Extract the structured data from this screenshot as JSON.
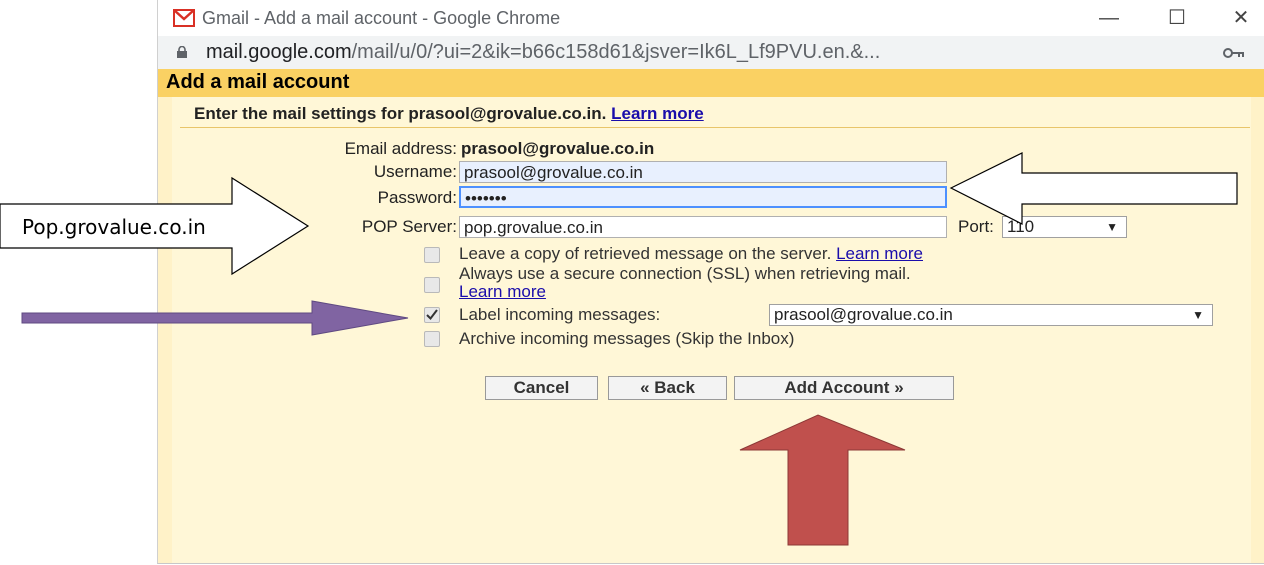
{
  "window": {
    "title": "Gmail - Add a mail account - Google Chrome",
    "minimize": "—",
    "maximize": "☐",
    "close": "✕"
  },
  "addressbar": {
    "host": "mail.google.com",
    "path": "/mail/u/0/?ui=2&ik=b66c158d61&jsver=Ik6L_Lf9PVU.en.&..."
  },
  "dialog": {
    "title": "Add a mail account",
    "intro_text": "Enter the mail settings for prasool@grovalue.co.in.",
    "intro_link": "Learn more",
    "email_label": "Email address:",
    "email_value": "prasool@grovalue.co.in",
    "username_label": "Username:",
    "username_value": "prasool@grovalue.co.in",
    "password_label": "Password:",
    "password_value": "•••••••",
    "pop_label": "POP Server:",
    "pop_value": "pop.grovalue.co.in",
    "port_label": "Port:",
    "port_value": "110",
    "options": [
      {
        "label": "Leave a copy of retrieved message on the server.",
        "link": "Learn more",
        "checked": false
      },
      {
        "label": "Always use a secure connection (SSL) when retrieving mail.",
        "link": "Learn more",
        "checked": false
      },
      {
        "label": "Label incoming messages:",
        "select_value": "prasool@grovalue.co.in",
        "checked": true
      },
      {
        "label": "Archive incoming messages (Skip the Inbox)",
        "checked": false
      }
    ],
    "buttons": {
      "cancel": "Cancel",
      "back": "« Back",
      "add": "Add Account »"
    }
  },
  "annotation": {
    "callout_text": "Pop.grovalue.co.in"
  },
  "colors": {
    "header_bg": "#fad163",
    "dialog_bg": "#fff7d7",
    "link": "#1a0dab",
    "focus_border": "#4d90fe",
    "purple_arrow": "#8064a2",
    "red_arrow": "#c0504d"
  }
}
